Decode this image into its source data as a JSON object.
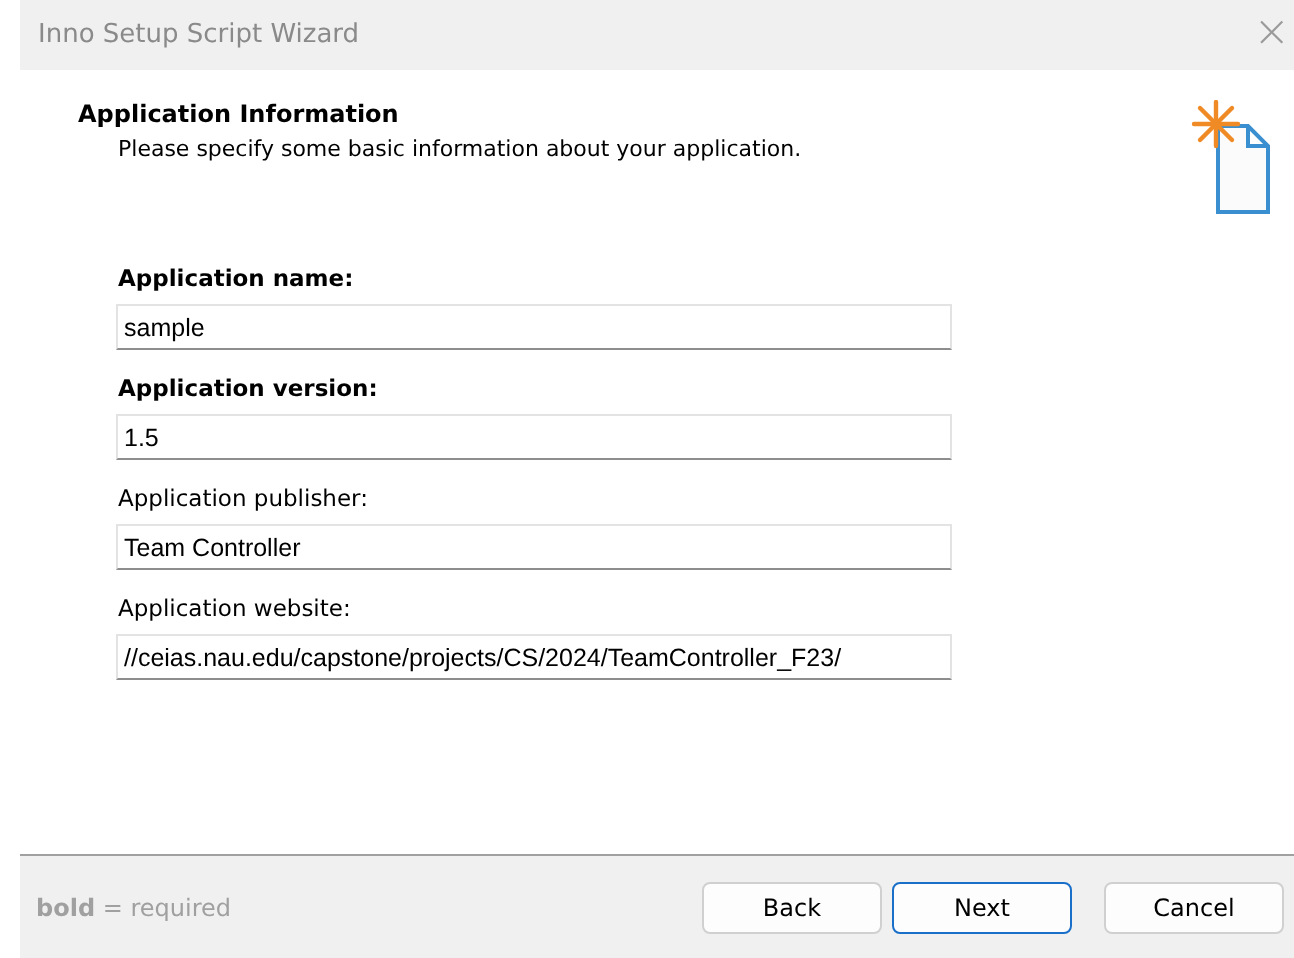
{
  "window": {
    "title": "Inno Setup Script Wizard",
    "close": "×"
  },
  "header": {
    "title": "Application Information",
    "subtitle": "Please specify some basic information about your application."
  },
  "fields": [
    {
      "label": "Application name:",
      "required": true,
      "value": "sample"
    },
    {
      "label": "Application version:",
      "required": true,
      "value": "1.5"
    },
    {
      "label": "Application publisher:",
      "required": false,
      "value": "Team Controller"
    },
    {
      "label": "Application website:",
      "required": false,
      "value": "//ceias.nau.edu/capstone/projects/CS/2024/TeamController_F23/"
    }
  ],
  "footer": {
    "hint": "**bold** = required",
    "buttons": [
      {
        "label": "Back",
        "default": false
      },
      {
        "label": "Next",
        "default": true
      },
      {
        "label": "Cancel",
        "default": false
      }
    ]
  }
}
